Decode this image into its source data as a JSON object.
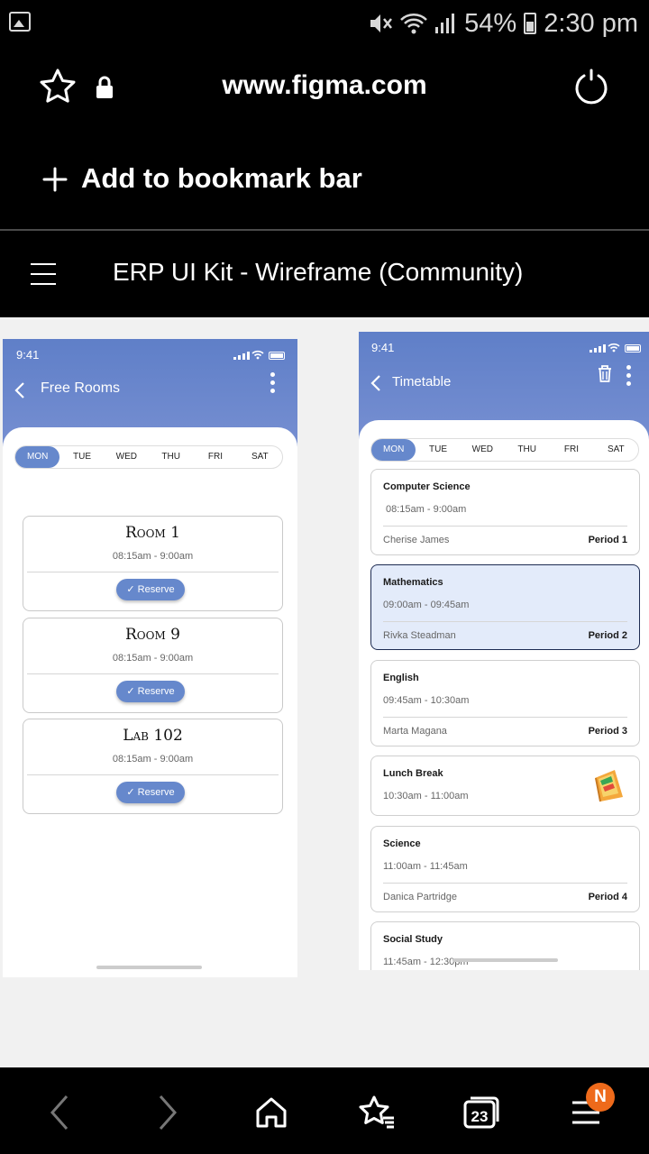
{
  "status_bar": {
    "battery": "54%",
    "time": "2:30 pm"
  },
  "browser": {
    "url": "www.figma.com",
    "bookmark_label": "Add to bookmark bar",
    "tab_count": "23",
    "notification_badge": "N"
  },
  "figma": {
    "file_title": "ERP UI Kit - Wireframe (Community)"
  },
  "free_rooms": {
    "time": "9:41",
    "title": "Free Rooms",
    "days": [
      "MON",
      "TUE",
      "WED",
      "THU",
      "FRI",
      "SAT"
    ],
    "active_day": "MON",
    "rooms": [
      {
        "name": "Room 1",
        "time": "08:15am - 9:00am",
        "button": "Reserve"
      },
      {
        "name": "Room 9",
        "time": "08:15am - 9:00am",
        "button": "Reserve"
      },
      {
        "name": "Lab 102",
        "time": "08:15am - 9:00am",
        "button": "Reserve"
      }
    ]
  },
  "timetable": {
    "time": "9:41",
    "title": "Timetable",
    "days": [
      "MON",
      "TUE",
      "WED",
      "THU",
      "FRI",
      "SAT"
    ],
    "active_day": "MON",
    "entries": [
      {
        "subject": "Computer Science",
        "time": "08:15am - 9:00am",
        "teacher": "Cherise James",
        "period": "Period 1"
      },
      {
        "subject": "Mathematics",
        "time": "09:00am - 09:45am",
        "teacher": "Rivka Steadman",
        "period": "Period 2"
      },
      {
        "subject": "English",
        "time": "09:45am - 10:30am",
        "teacher": "Marta Magana",
        "period": "Period 3"
      },
      {
        "subject": "Lunch Break",
        "time": "10:30am - 11:00am"
      },
      {
        "subject": "Science",
        "time": "11:00am - 11:45am",
        "teacher": "Danica Partridge",
        "period": "Period 4"
      },
      {
        "subject": "Social Study",
        "time": "11:45am - 12:30pm"
      }
    ]
  },
  "colors": {
    "accent": "#6688cc",
    "highlight": "#e3ebfa",
    "badge": "#ee6a1b"
  }
}
